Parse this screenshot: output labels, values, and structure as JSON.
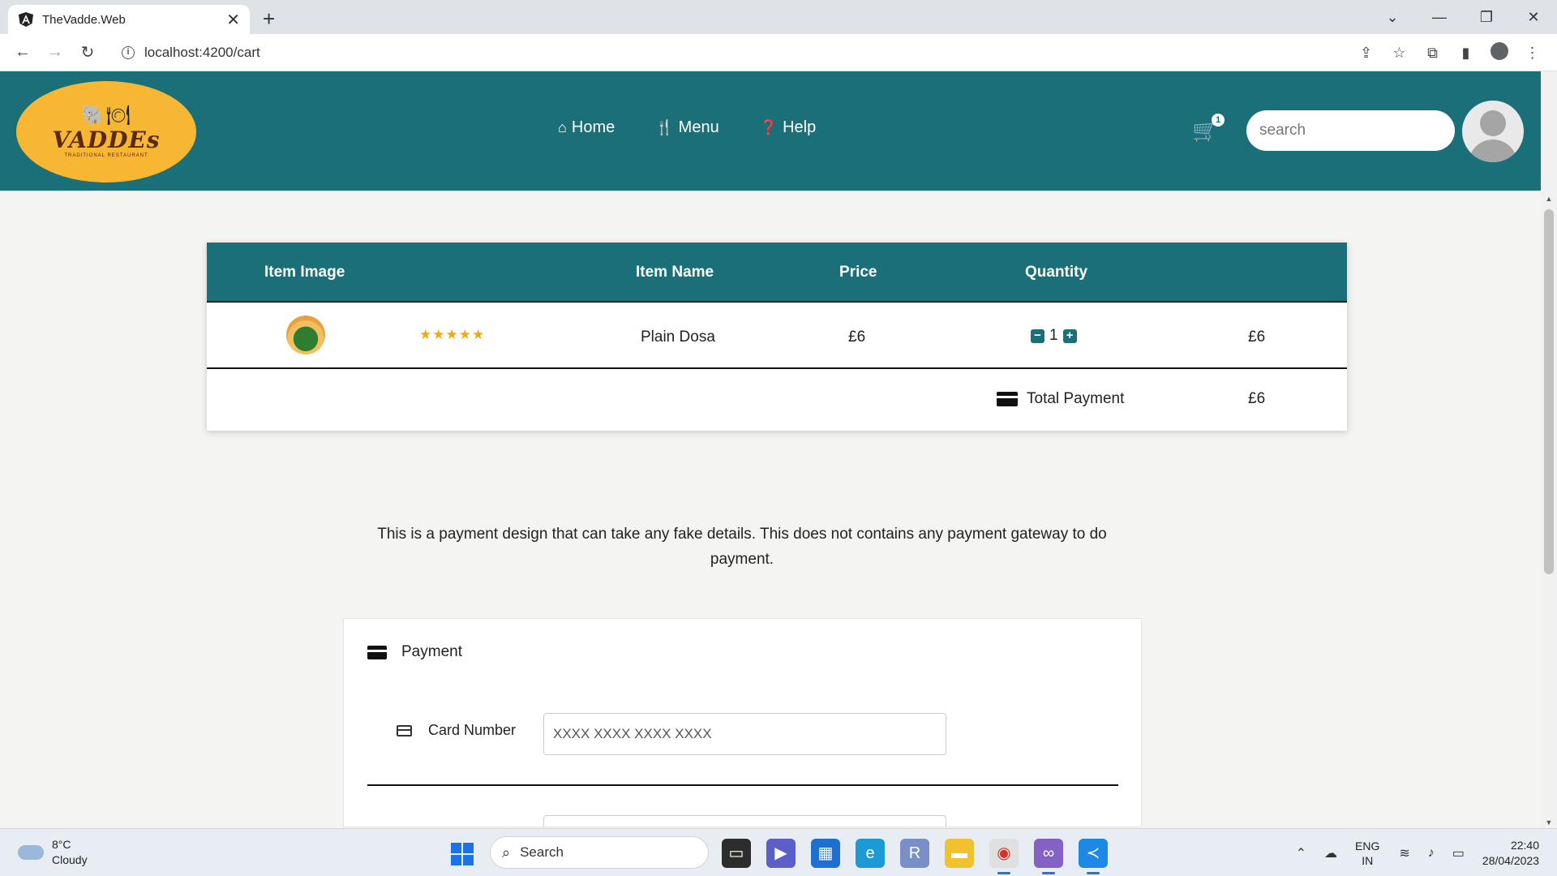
{
  "browser": {
    "tab_title": "TheVadde.Web",
    "tab_close": "✕",
    "new_tab": "+",
    "url": "localhost:4200/cart",
    "window_controls": [
      "⌄",
      "—",
      "❐",
      "✕"
    ]
  },
  "header": {
    "logo_text": "VADDEs",
    "logo_sub": "TRADITIONAL RESTAURANT",
    "nav": [
      {
        "icon": "home-icon",
        "label": "Home"
      },
      {
        "icon": "utensils-icon",
        "label": "Menu"
      },
      {
        "icon": "question-circle-icon",
        "label": "Help"
      }
    ],
    "cart_count": "1",
    "search_placeholder": "search"
  },
  "cart": {
    "columns": [
      "Item Image",
      "Item Name",
      "Price",
      "Quantity"
    ],
    "items": [
      {
        "name": "Plain Dosa",
        "rating_stars": "★★★★★",
        "rating": 5,
        "price": "£6",
        "quantity": "1",
        "subtotal": "£6"
      }
    ],
    "total_label": "Total Payment",
    "total_value": "£6"
  },
  "notice": "This is a payment design that can take any fake details. This does not contains any payment gateway to do payment.",
  "payment": {
    "title": "Payment",
    "card_number_label": "Card Number",
    "card_number_placeholder": "XXXX XXXX XXXX XXXX"
  },
  "taskbar": {
    "temperature": "8°C",
    "condition": "Cloudy",
    "search_label": "Search",
    "language_line1": "ENG",
    "language_line2": "IN",
    "time": "22:40",
    "date": "28/04/2023"
  },
  "colors": {
    "header_teal": "#1b6f78",
    "logo_yellow": "#f7b733",
    "star_gold": "#f1a817"
  }
}
